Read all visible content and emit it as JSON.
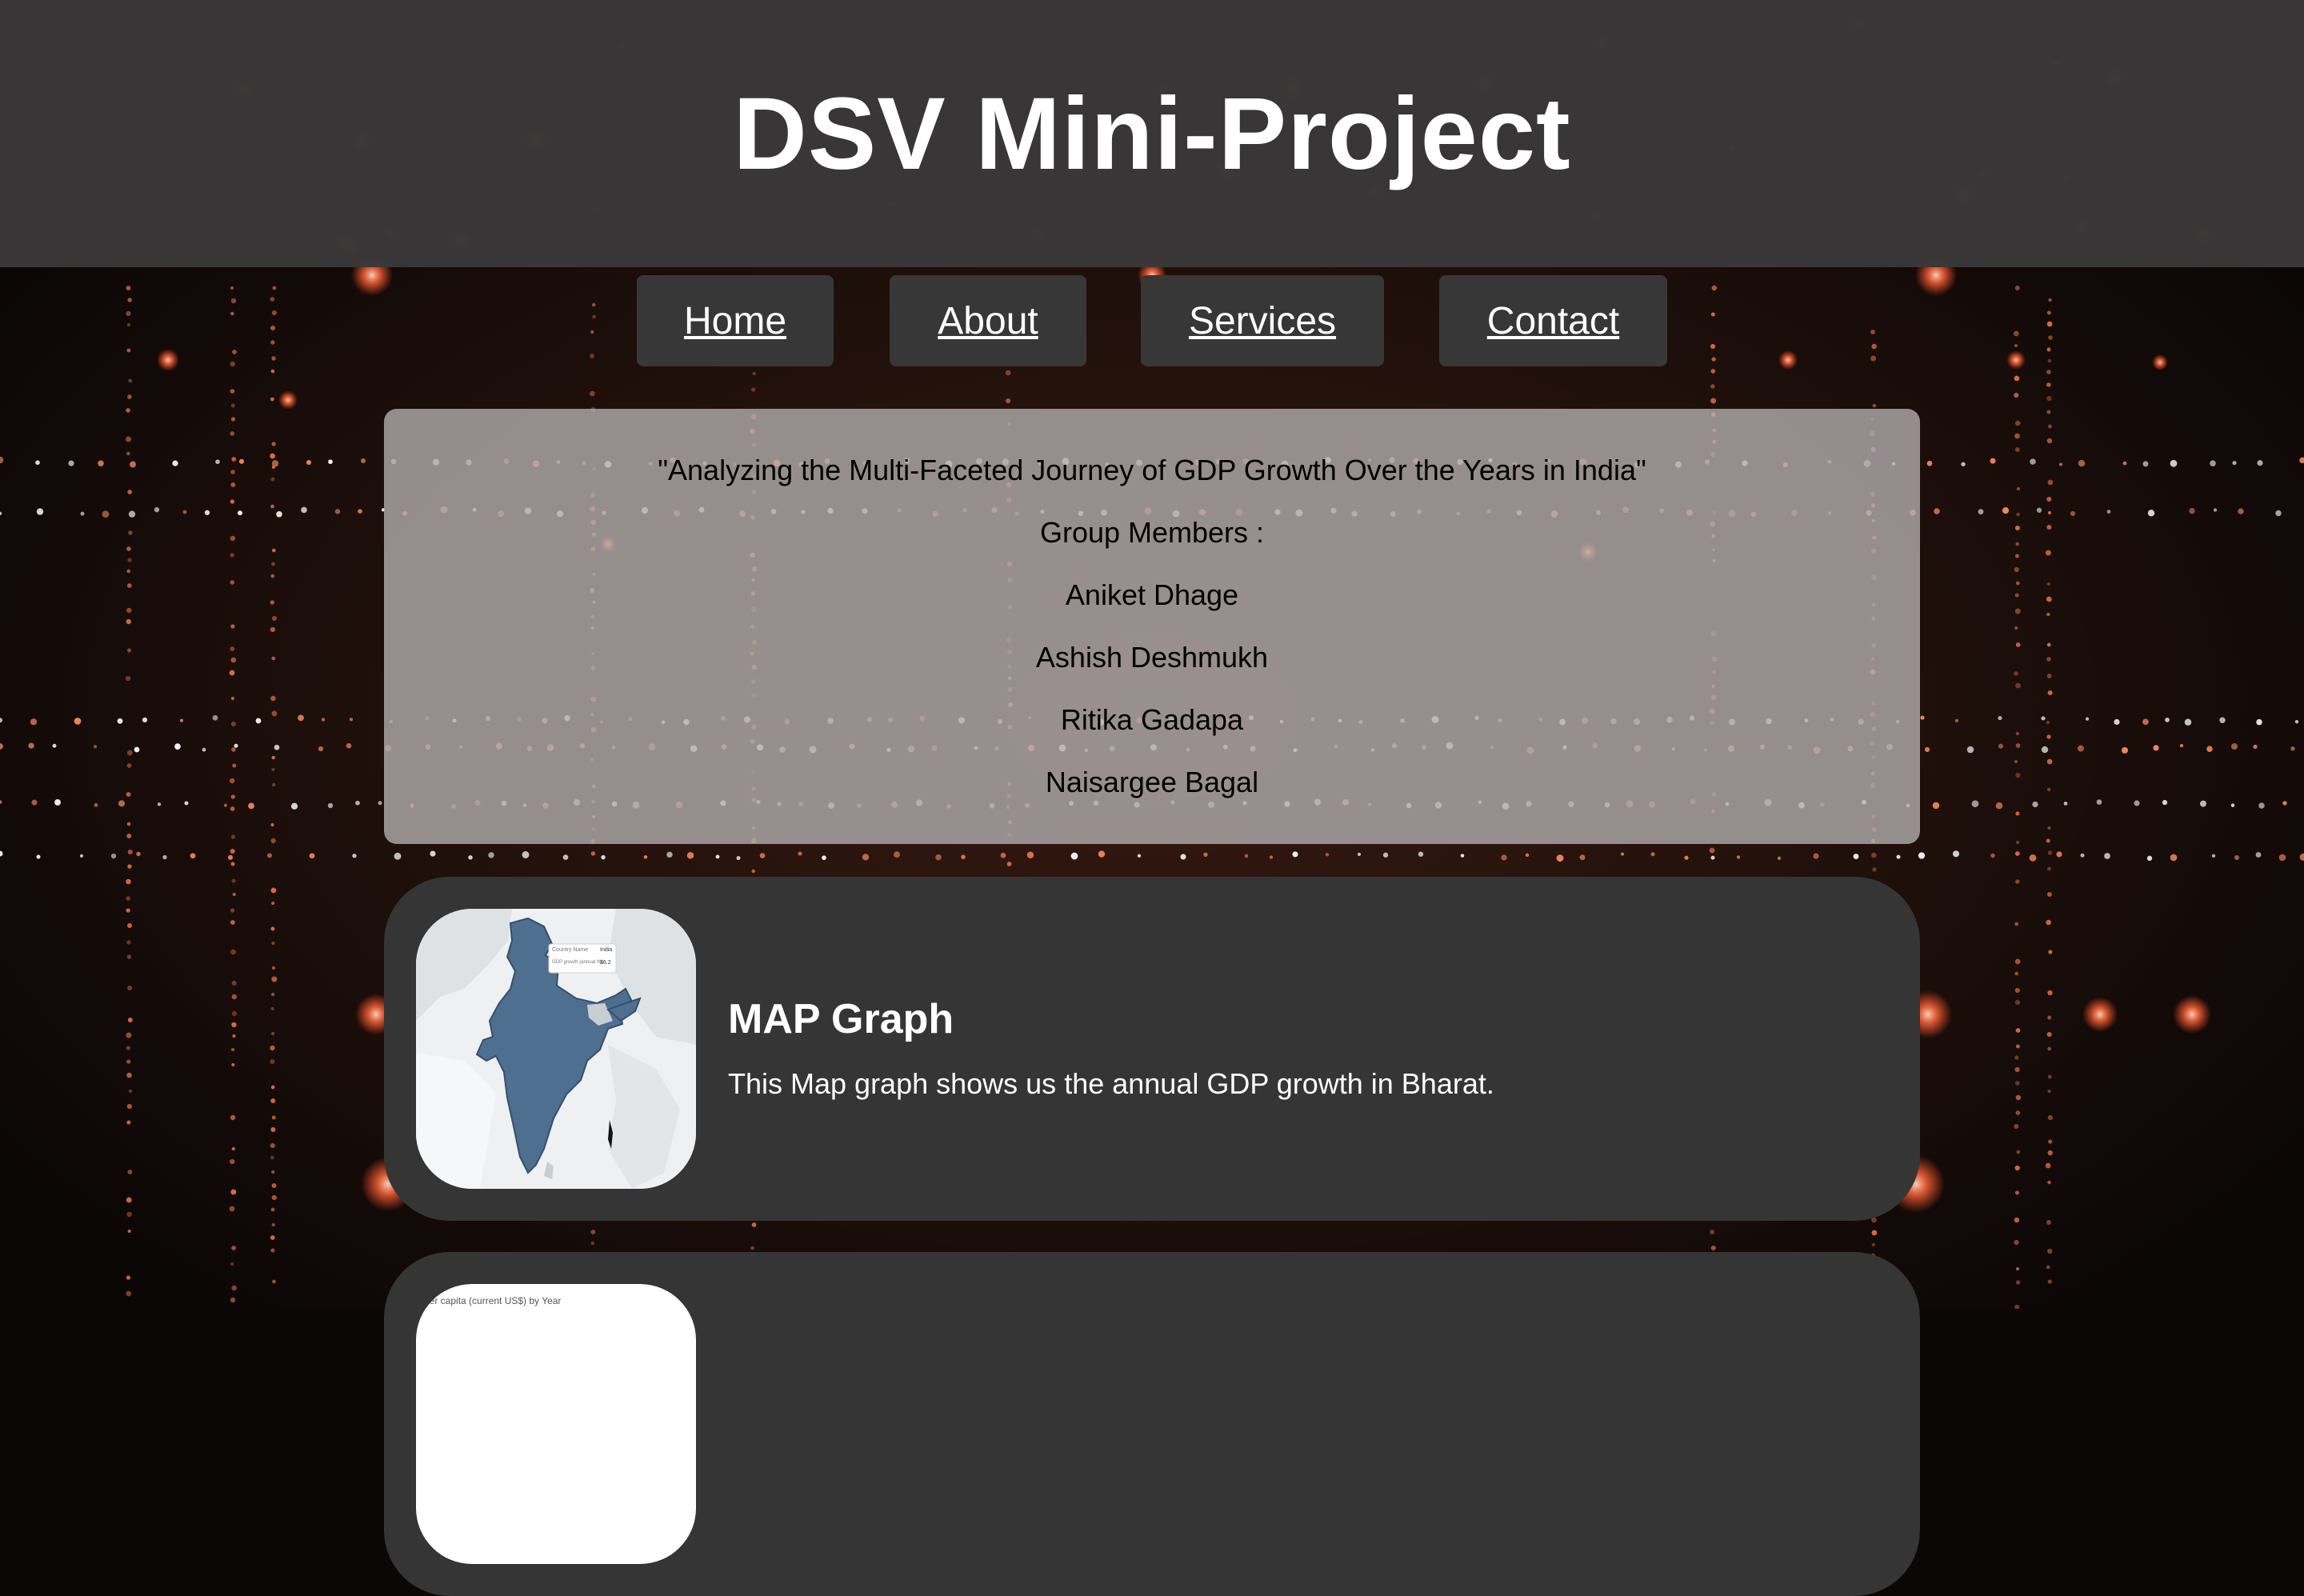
{
  "header": {
    "title": "DSV Mini-Project"
  },
  "nav": {
    "items": [
      "Home",
      "About",
      "Services",
      "Contact"
    ]
  },
  "intro": {
    "project_title": "\"Analyzing the Multi-Faceted Journey of GDP Growth Over the Years in India\"",
    "members_heading": "Group Members :",
    "members": [
      "Aniket Dhage",
      "Ashish Deshmukh",
      "Ritika Gadapa",
      "Naisargee Bagal"
    ]
  },
  "cards": [
    {
      "title": "MAP Graph",
      "description": "This Map graph shows us the annual GDP growth in Bharat.",
      "thumbnail": {
        "icon": "india-map-icon",
        "tooltip_label": "Country Name",
        "tooltip_country": "India",
        "tooltip_metric": "GDP growth (annual %)",
        "tooltip_value": "$6.2"
      }
    },
    {
      "thumbnail": {
        "icon": "chart-icon",
        "label": "per capita (current US$) by Year"
      }
    }
  ],
  "colors": {
    "header_bg": "#3a3839",
    "nav_bg": "#373737",
    "intro_bg": "#b2aeae",
    "card_bg": "#353535",
    "map_fill": "#4f6f91",
    "glow": "#ff6a3d"
  }
}
